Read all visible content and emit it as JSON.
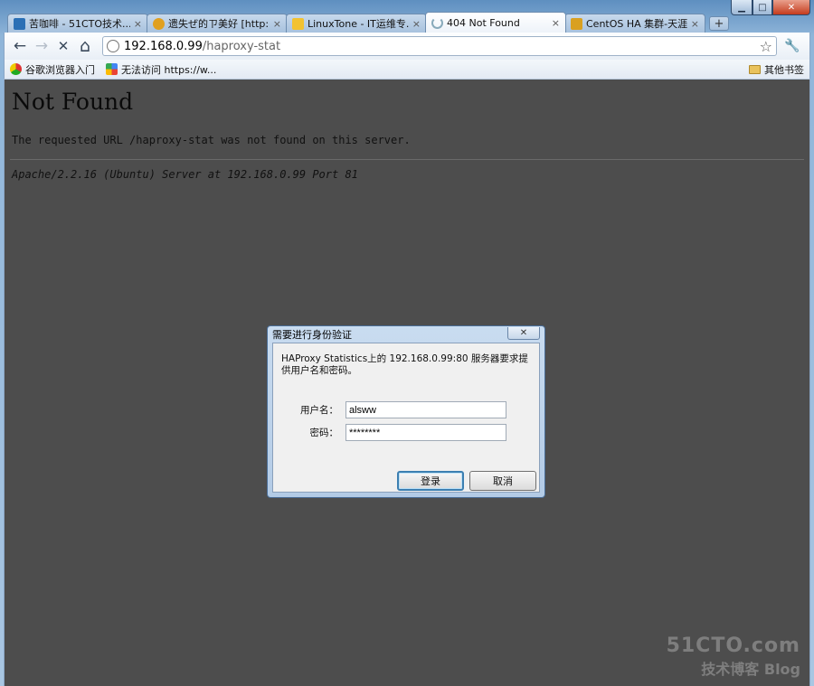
{
  "window": {
    "controls": {
      "minimize": "▁",
      "maximize": "□",
      "close": "✕"
    }
  },
  "tabs": [
    {
      "label": "苦咖啡 - 51CTO技术...",
      "icon": "51cto-favicon",
      "color": "#2a6fb5",
      "active": false
    },
    {
      "label": "遗失ぜ的ㄗ美好 [http:...",
      "icon": "star-favicon",
      "color": "#e0a020",
      "active": false
    },
    {
      "label": "LinuxTone - IT运维专...",
      "icon": "linuxtone-favicon",
      "color": "#f2c230",
      "active": false
    },
    {
      "label": "404 Not Found",
      "icon": "loading-spinner-icon",
      "color": "#ffffff",
      "active": true
    },
    {
      "label": "CentOS HA 集群-天涯...",
      "icon": "hand-favicon",
      "color": "#d9a020",
      "active": false
    }
  ],
  "tab_close": "×",
  "new_tab": "+",
  "toolbar": {
    "back": "←",
    "forward": "→",
    "stop": "✕",
    "home": "⌂",
    "url_host": "192.168.0.99",
    "url_path": "/haproxy-stat",
    "bookmark_star": "☆",
    "wrench": "🔧"
  },
  "bookmarks": {
    "items": [
      {
        "label": "谷歌浏览器入门"
      },
      {
        "label": "无法访问 https://w..."
      }
    ],
    "other": "其他书签"
  },
  "page": {
    "heading": "Not Found",
    "message": "The requested URL /haproxy-stat was not found on this server.",
    "address": "Apache/2.2.16 (Ubuntu) Server at 192.168.0.99 Port 81"
  },
  "dialog": {
    "title": "需要进行身份验证",
    "close": "✕",
    "message": "HAProxy Statistics上的 192.168.0.99:80 服务器要求提供用户名和密码。",
    "username_label": "用户名：",
    "username_value": "alsww",
    "password_label": "密码：",
    "password_value": "********",
    "login_button": "登录",
    "cancel_button": "取消"
  },
  "watermark": {
    "line1": "51CTO.com",
    "line2": "技术博客 Blog"
  }
}
